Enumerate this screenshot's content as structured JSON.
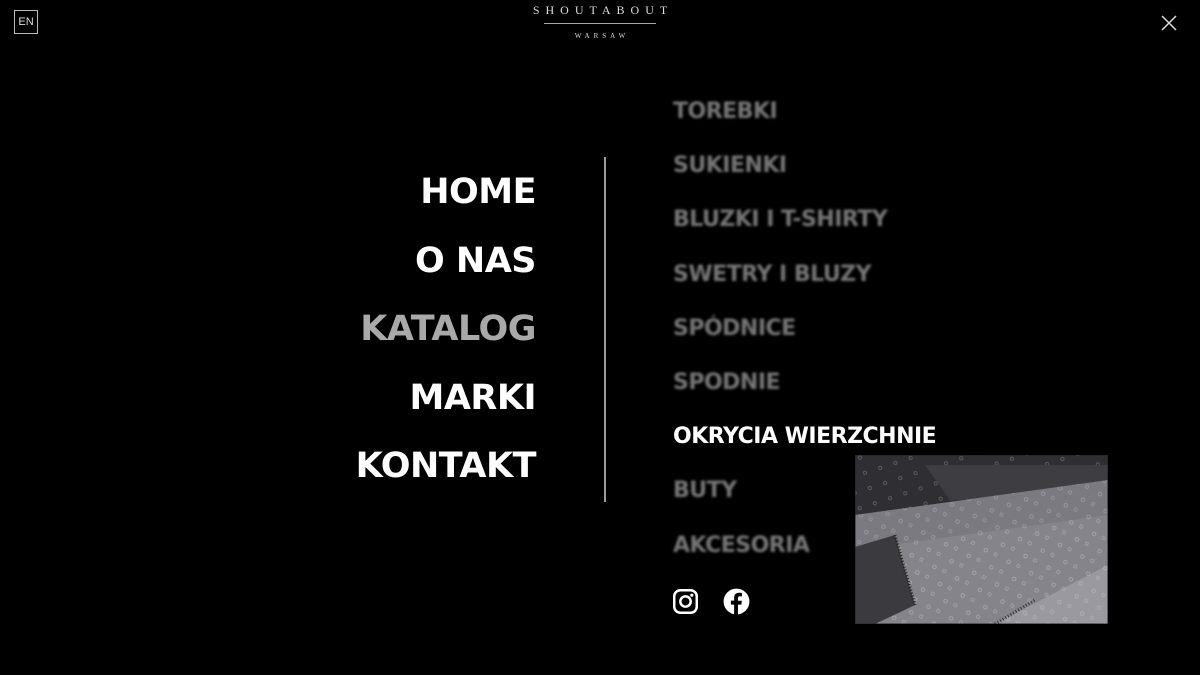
{
  "header": {
    "lang_label": "EN",
    "logo_name": "SHOUTABOUT",
    "logo_city": "WARSAW"
  },
  "main_nav": {
    "items": [
      {
        "label": "HOME",
        "dimmed": false
      },
      {
        "label": "O NAS",
        "dimmed": false
      },
      {
        "label": "KATALOG",
        "dimmed": true
      },
      {
        "label": "MARKI",
        "dimmed": false
      },
      {
        "label": "KONTAKT",
        "dimmed": false
      }
    ]
  },
  "sub_nav": {
    "items": [
      {
        "label": "TOREBKI",
        "active": false
      },
      {
        "label": "SUKIENKI",
        "active": false
      },
      {
        "label": "BLUZKI I T-SHIRTY",
        "active": false
      },
      {
        "label": "SWETRY I BLUZY",
        "active": false
      },
      {
        "label": "SPÓDNICE",
        "active": false
      },
      {
        "label": "SPODNIE",
        "active": false
      },
      {
        "label": "OKRYCIA WIERZCHNIE",
        "active": true
      },
      {
        "label": "BUTY",
        "active": false
      },
      {
        "label": "AKCESORIA",
        "active": false
      }
    ]
  },
  "social": {
    "icons": [
      "instagram-icon",
      "facebook-icon"
    ]
  },
  "preview": {
    "subject": "monogram scarves photo"
  },
  "colors": {
    "background": "#000000",
    "text": "#ffffff",
    "dimmed_text": "#a9a9a9",
    "inactive_sub": "#757575",
    "divider": "#9c9c9c"
  }
}
